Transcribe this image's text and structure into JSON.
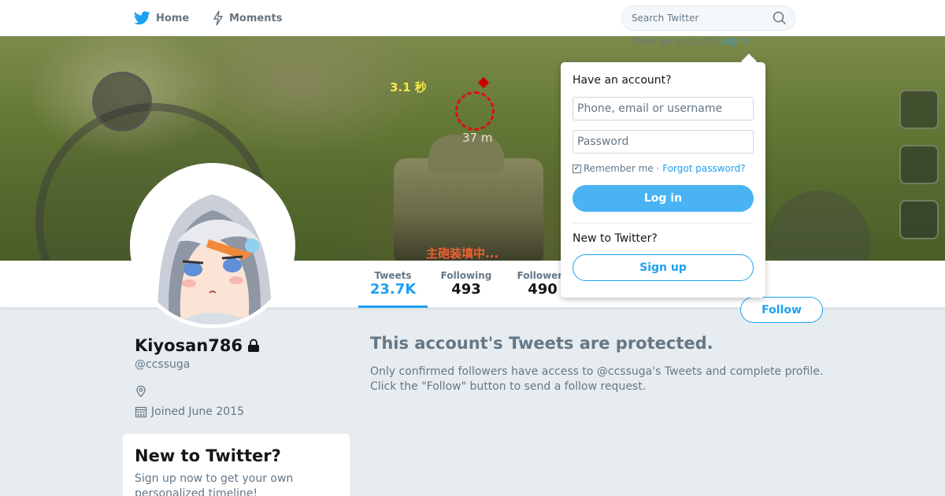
{
  "nav": {
    "home_label": "Home",
    "home_icon": "twitter-bird-icon",
    "moments_label": "Moments",
    "moments_icon": "lightning-icon",
    "search_placeholder": "Search Twitter",
    "search_icon": "search-icon"
  },
  "login_hint": {
    "prefix": "Have an account?",
    "link": "Log in"
  },
  "banner_text": {
    "timer": "3.1 秒",
    "distance": "37 m",
    "reload": "主砲装填中..."
  },
  "stats": {
    "tweets_label": "Tweets",
    "tweets_value": "23.7K",
    "following_label": "Following",
    "following_value": "493",
    "followers_label": "Followers",
    "followers_value": "490"
  },
  "follow_label": "Follow",
  "profile": {
    "name": "Kiyosan786",
    "lock_icon": "lock-icon",
    "handle": "@ccssuga",
    "location_icon": "location-pin-icon",
    "joined_icon": "calendar-icon",
    "joined": "Joined June 2015"
  },
  "signup_card": {
    "title": "New to Twitter?",
    "text": "Sign up now to get your own personalized timeline!"
  },
  "protected": {
    "title": "This account's Tweets are protected.",
    "text": "Only confirmed followers have access to @ccssuga's Tweets and complete profile. Click the \"Follow\" button to send a follow request."
  },
  "login_dropdown": {
    "title": "Have an account?",
    "username_placeholder": "Phone, email or username",
    "password_placeholder": "Password",
    "remember_label": "Remember me",
    "separator": " · ",
    "forgot_label": "Forgot password?",
    "login_label": "Log in",
    "new_label": "New to Twitter?",
    "signup_label": "Sign up"
  },
  "colors": {
    "brand": "#1da1f2",
    "background": "#e6ecf0",
    "text_secondary": "#657786"
  }
}
